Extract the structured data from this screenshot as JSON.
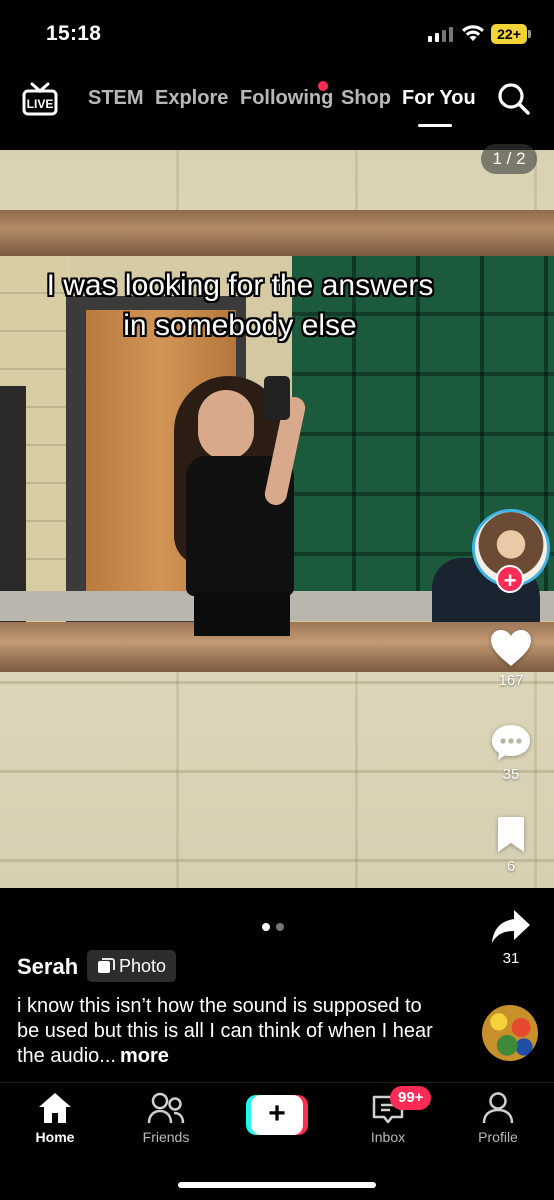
{
  "status_bar": {
    "time": "15:18",
    "battery": "22+"
  },
  "top_nav": {
    "tabs": [
      {
        "label": "STEM"
      },
      {
        "label": "Explore"
      },
      {
        "label": "Following"
      },
      {
        "label": "Shop"
      },
      {
        "label": "For You",
        "active": true
      }
    ],
    "live_label": "LIVE"
  },
  "post": {
    "page_counter": "1 / 2",
    "overlay_text": "I was looking for the answers in somebody else",
    "likes": "167",
    "comments": "35",
    "saves": "6",
    "shares": "31",
    "follow_symbol": "+",
    "carousel": {
      "count": 2,
      "current": 1
    },
    "author": "Serah",
    "badge": "Photo",
    "description": "i know this isn’t how the sound is supposed to be used but this is all I can think of when I hear the audio...",
    "more_label": "more"
  },
  "tab_bar": {
    "tabs": [
      {
        "label": "Home",
        "icon": "home-icon",
        "active": true
      },
      {
        "label": "Friends",
        "icon": "friends-icon"
      },
      {
        "label": "",
        "icon": "plus-icon"
      },
      {
        "label": "Inbox",
        "icon": "inbox-icon"
      },
      {
        "label": "Profile",
        "icon": "profile-icon"
      }
    ],
    "create_symbol": "+",
    "inbox_badge": "99+"
  },
  "colors": {
    "accent": "#fe2c55",
    "cyan": "#25f4ee",
    "battery": "#f1d437",
    "avatar_ring": "#3fb5e6"
  }
}
